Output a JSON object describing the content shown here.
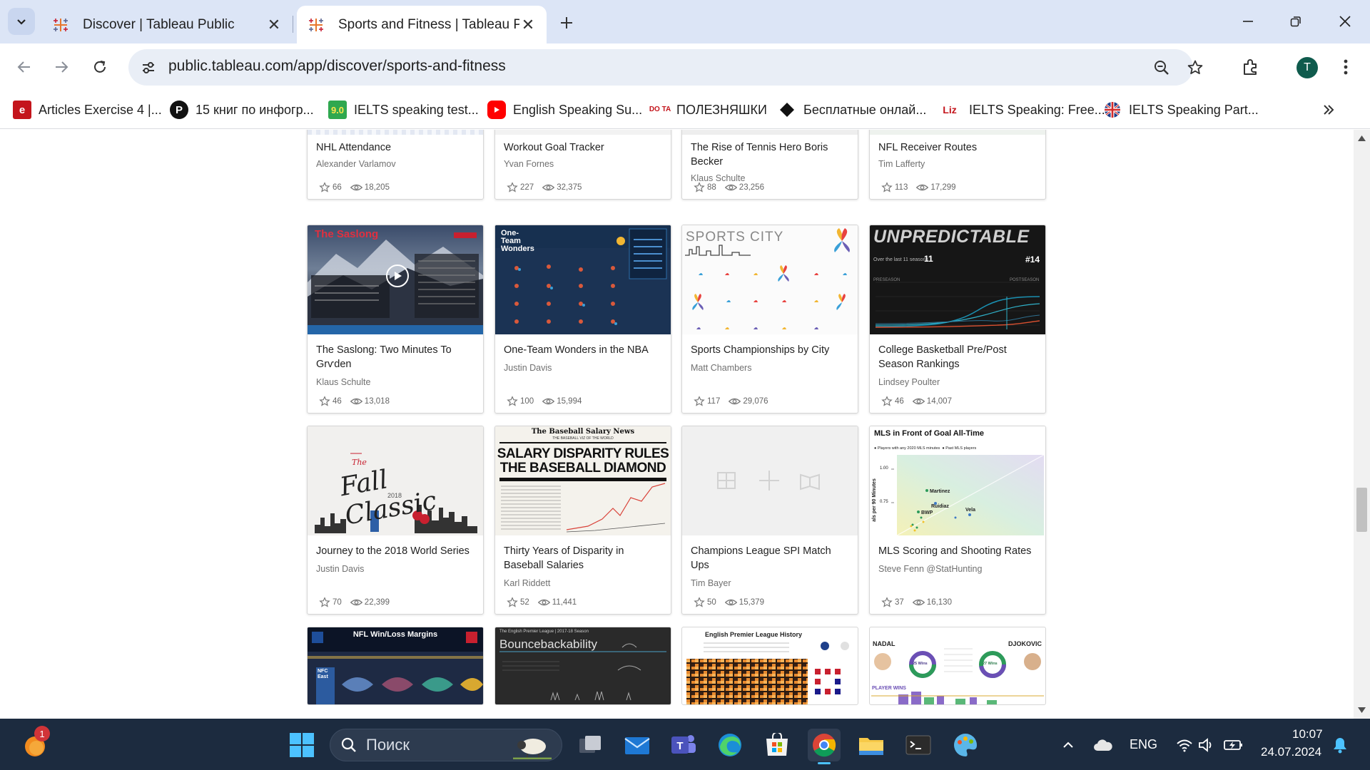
{
  "browser": {
    "tabs": [
      {
        "title": "Discover | Tableau Public",
        "active": false
      },
      {
        "title": "Sports and Fitness | Tableau Pul",
        "active": true
      }
    ],
    "url": "public.tableau.com/app/discover/sports-and-fitness",
    "profile_initial": "T",
    "bookmarks": [
      {
        "label": "Articles Exercise 4 |...",
        "icon": "e-icon"
      },
      {
        "label": "15 книг по инфогр...",
        "icon": "p-icon"
      },
      {
        "label": "IELTS speaking test...",
        "icon": "9-icon",
        "icon_text": "9.0"
      },
      {
        "label": "English Speaking Su...",
        "icon": "youtube-icon"
      },
      {
        "label": "ПОЛЕЗНЯШКИ",
        "icon": "dota-icon",
        "icon_text": "DO TA"
      },
      {
        "label": "Бесплатные онлай...",
        "icon": "diamond-icon"
      },
      {
        "label": "IELTS Speaking: Free...",
        "icon": "liz-icon",
        "icon_text": "Liz"
      },
      {
        "label": "IELTS Speaking Part...",
        "icon": "uk-flag-icon"
      }
    ]
  },
  "cards": [
    {
      "title": "NHL Attendance",
      "author": "Alexander Varlamov",
      "favorites": "66",
      "views": "18,205"
    },
    {
      "title": "Workout Goal Tracker",
      "author": "Yvan Fornes",
      "favorites": "227",
      "views": "32,375"
    },
    {
      "title": "The Rise of Tennis Hero Boris Becker",
      "author": "Klaus Schulte",
      "favorites": "88",
      "views": "23,256"
    },
    {
      "title": "NFL Receiver Routes",
      "author": "Tim Lafferty",
      "favorites": "113",
      "views": "17,299"
    },
    {
      "title": "The Saslong: Two Minutes To Grѵden",
      "author": "Klaus Schulte",
      "favorites": "46",
      "views": "13,018"
    },
    {
      "title": "One-Team Wonders in the NBA",
      "author": "Justin Davis",
      "favorites": "100",
      "views": "15,994"
    },
    {
      "title": "Sports Championships by City",
      "author": "Matt Chambers",
      "favorites": "117",
      "views": "29,076"
    },
    {
      "title": "College Basketball Pre/Post Season Rankings",
      "author": "Lindsey Poulter",
      "favorites": "46",
      "views": "14,007"
    },
    {
      "title": "Journey to the 2018 World Series",
      "author": "Justin Davis",
      "favorites": "70",
      "views": "22,399"
    },
    {
      "title": "Thirty Years of Disparity in Baseball Salaries",
      "author": "Karl Riddett",
      "favorites": "52",
      "views": "11,441"
    },
    {
      "title": "Champions League SPI Match Ups",
      "author": "Tim Bayer",
      "favorites": "50",
      "views": "15,379"
    },
    {
      "title": "MLS Scoring and Shooting Rates",
      "author": "Steve Fenn @StatHunting",
      "favorites": "37",
      "views": "16,130"
    }
  ],
  "thumbnails": {
    "saslong": {
      "title": "The Saslong"
    },
    "nba": {
      "title": "One-Team Wonders"
    },
    "sports_city": {
      "title": "SPORTS CITY"
    },
    "unpredictable": {
      "title": "UNPREDICTABLE",
      "subtitle": "Over the last 11 seasons",
      "big_number": "11",
      "rank": "#14",
      "left_label": "PRESEASON",
      "right_label": "POSTSEASON"
    },
    "fall_classic": {
      "title": "Fall Classic",
      "prefix": "The",
      "year": "2018"
    },
    "baseball": {
      "masthead": "The Baseball Salary News",
      "tagline": "THE BASEBALL VIZ OF THE WORLD",
      "headline_1": "SALARY DISPARITY RULES",
      "headline_2": "THE BASEBALL DIAMOND"
    },
    "mls": {
      "title": "MLS in Front of Goal All-Time",
      "legend_1": "Players with any 2020 MLS minutes",
      "legend_2": "Past MLS players",
      "y_axis": "als per 90 Minutes",
      "tick_top": "1.00",
      "tick_mid": "0.75",
      "names": [
        "Martinez",
        "Ruidiaz",
        "BWP",
        "Vela"
      ]
    },
    "nfl": {
      "title": "NFL Win/Loss Margins",
      "division": "NFC East"
    },
    "bounce": {
      "header": "The English Premier League | 2017-18 Season",
      "title": "Bouncebackability"
    },
    "epl": {
      "title": "English Premier League History"
    },
    "tennis": {
      "left": "NADAL",
      "right": "DJOKOVIC",
      "wins_left": "25 Wins",
      "wins_right": "27 Wins",
      "label": "PLAYER WINS"
    }
  },
  "taskbar": {
    "search_placeholder": "Поиск",
    "language": "ENG",
    "time": "10:07",
    "date": "24.07.2024",
    "notification_count": "1"
  }
}
